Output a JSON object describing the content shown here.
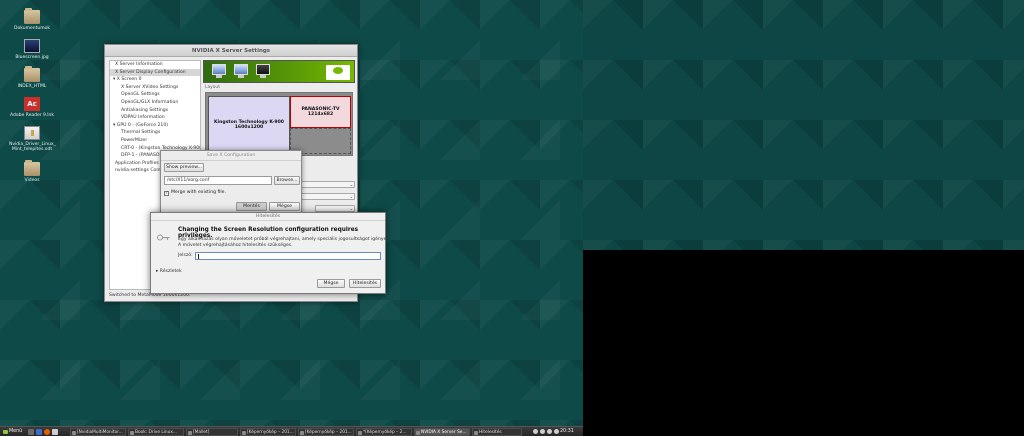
{
  "desktop": {
    "icons": [
      {
        "label": "Dokumentumok",
        "kind": "folder"
      },
      {
        "label": "Bluescreen.jpg",
        "kind": "image"
      },
      {
        "label": "INDEX_HTML",
        "kind": "folder"
      },
      {
        "label": "Adobe Reader 9.lnk",
        "kind": "pdf"
      },
      {
        "label": "Nvidia_Driver_Linux_",
        "label2": "Mint_telepites.odt",
        "kind": "document"
      },
      {
        "label": "Videos",
        "kind": "folder"
      }
    ]
  },
  "nvidia_window": {
    "title": "NVIDIA X Server Settings",
    "tree": [
      {
        "label": "X Server Information",
        "indent": 0
      },
      {
        "label": "X Server Display Configuration",
        "indent": 0,
        "selected": true
      },
      {
        "label": "▾ X Screen 0",
        "indent": 0
      },
      {
        "label": "X Server XVideo Settings",
        "indent": 1
      },
      {
        "label": "OpenGL Settings",
        "indent": 1
      },
      {
        "label": "OpenGL/GLX Information",
        "indent": 1
      },
      {
        "label": "Antialiasing Settings",
        "indent": 1
      },
      {
        "label": "VDPAU Information",
        "indent": 1
      },
      {
        "label": "▾ GPU 0 - (GeForce 210)",
        "indent": 0
      },
      {
        "label": "Thermal Settings",
        "indent": 1
      },
      {
        "label": "PowerMizer",
        "indent": 1
      },
      {
        "label": "CRT-0 - (Kingston Technology K-900)",
        "indent": 1
      },
      {
        "label": "DFP-1 - (PANASONIC-TV)",
        "indent": 1
      },
      {
        "label": "Application Profiles",
        "indent": 0
      },
      {
        "label": "nvidia-settings Configuration",
        "indent": 0
      }
    ],
    "layout_label": "Layout",
    "displays": [
      {
        "name": "Kingston Technology K-900",
        "resolution": "1600x1200"
      },
      {
        "name": "PANASONIC-TV",
        "resolution": "1214x682"
      }
    ],
    "status": "Switched to MetaMode 1600x1200."
  },
  "save_dialog": {
    "title": "Save X Configuration",
    "show_preview_label": "Show preview...",
    "path_value": "/etc/X11/xorg.conf",
    "browse_label": "Browse...",
    "merge_label": "Merge with existing file.",
    "merge_checked": "✓",
    "save_label": "Mentés",
    "cancel_label": "Mégse"
  },
  "auth_dialog": {
    "title": "Hitelesítés",
    "heading": "Changing the Screen Resolution configuration requires privileges.",
    "line1": "Egy alkalmazás olyan műveletet próbál végrehajtani, amely speciális jogosultságot igényel.",
    "line2": "A művelet végrehajtásához hitelesítés szükséges.",
    "password_label": "Jelszó:",
    "password_value": "",
    "details_label": "▸ Részletek",
    "cancel_label": "Mégse",
    "auth_label": "Hitelesítés"
  },
  "taskbar": {
    "menu_label": "Menü",
    "tasks": [
      {
        "label": "[NvidiaMultiMonitor..."
      },
      {
        "label": "Book: Drive Linux..."
      },
      {
        "label": "[Mallet]"
      },
      {
        "label": "[Képernyőkép – 201..."
      },
      {
        "label": "[Képernyőkép – 201..."
      },
      {
        "label": "*[Képernyőkép – 2..."
      },
      {
        "label": "NVIDIA X Server Se...",
        "active": true
      },
      {
        "label": "Hitelesítés"
      }
    ],
    "clock": "20:31"
  },
  "colors": {
    "desktop_teal": "#0e4a48",
    "nvidia_green": "#76b900",
    "display1_fill": "#dcd8f4",
    "display2_fill": "#f3d9de"
  }
}
